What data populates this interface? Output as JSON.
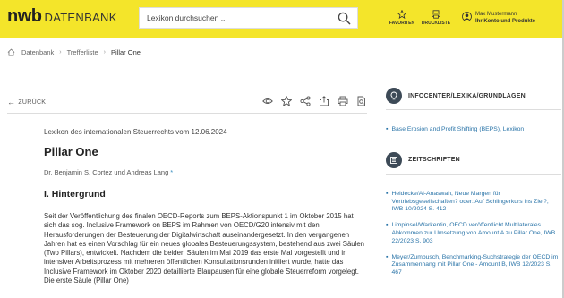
{
  "header": {
    "logo_main": "nwb",
    "logo_sub": "DATENBANK",
    "search_placeholder": "Lexikon durchsuchen ...",
    "favorites_label": "FAVORITEN",
    "print_list_label": "DRUCKLISTE",
    "user_name": "Max Mustermann",
    "account_label": "Ihr Konto und Produkte",
    "accent_color": "#f4e52a"
  },
  "breadcrumb": {
    "items": [
      "Datenbank",
      "Trefferliste",
      "Pillar One"
    ]
  },
  "toolbar": {
    "back_label": "ZURÜCK",
    "icons": [
      "eye-icon",
      "star-icon",
      "share-icon",
      "export-icon",
      "print-icon",
      "search-doc-icon"
    ]
  },
  "document": {
    "source": "Lexikon des internationalen Steuerrechts vom 12.06.2024",
    "title": "Pillar One",
    "authors": "Dr. Benjamin S. Cortez und Andreas Lang",
    "section_title": "I. Hintergrund",
    "body": "Seit der Veröffentlichung des finalen OECD-Reports zum BEPS-Aktionspunkt 1 im Oktober 2015 hat sich das sog. Inclusive Framework on BEPS im Rahmen von OECD/G20 intensiv mit den Herausforderungen der Besteuerung der Digitalwirtschaft auseinandergesetzt. In den vergangenen Jahren hat es einen Vorschlag für ein neues globales Besteuerungssystem, bestehend aus zwei Säulen (Two Pillars), entwickelt. Nachdem die beiden Säulen im Mai 2019 das erste Mal vorgestellt und in intensiver Arbeitsprozess mit mehreren öffentlichen Konsultationsrunden initiiert wurde, hatte das Inclusive Framework im Oktober 2020 detaillierte Blaupausen für eine globale Steuerreform vorgelegt. Die erste Säule (Pillar One)"
  },
  "sidebar": {
    "infocenter": {
      "heading": "INFOCENTER/LEXIKA/GRUNDLAGEN",
      "links": [
        "Base Erosion and Profit Shifting (BEPS), Lexikon"
      ]
    },
    "zeitschriften": {
      "heading": "ZEITSCHRIFTEN",
      "links": [
        "Heidecke/Al-Anaswah, Neue Margen für Vertriebsgesellschaften? oder: Auf Schlingerkurs ins Ziel?, IWB 10/2024 S. 412",
        "Limpinsel/Warkentin, OECD veröffentlicht Multilaterales Abkommen zur Umsetzung von Amount A zu Pillar One, IWB 22/2023 S. 903",
        "Meyer/Zumbusch, Benchmarking-Suchstrategie der OECD im Zusammenhang mit Pillar One - Amount B, IWB 12/2023 S. 467"
      ]
    },
    "link_color": "#2a74a8"
  }
}
